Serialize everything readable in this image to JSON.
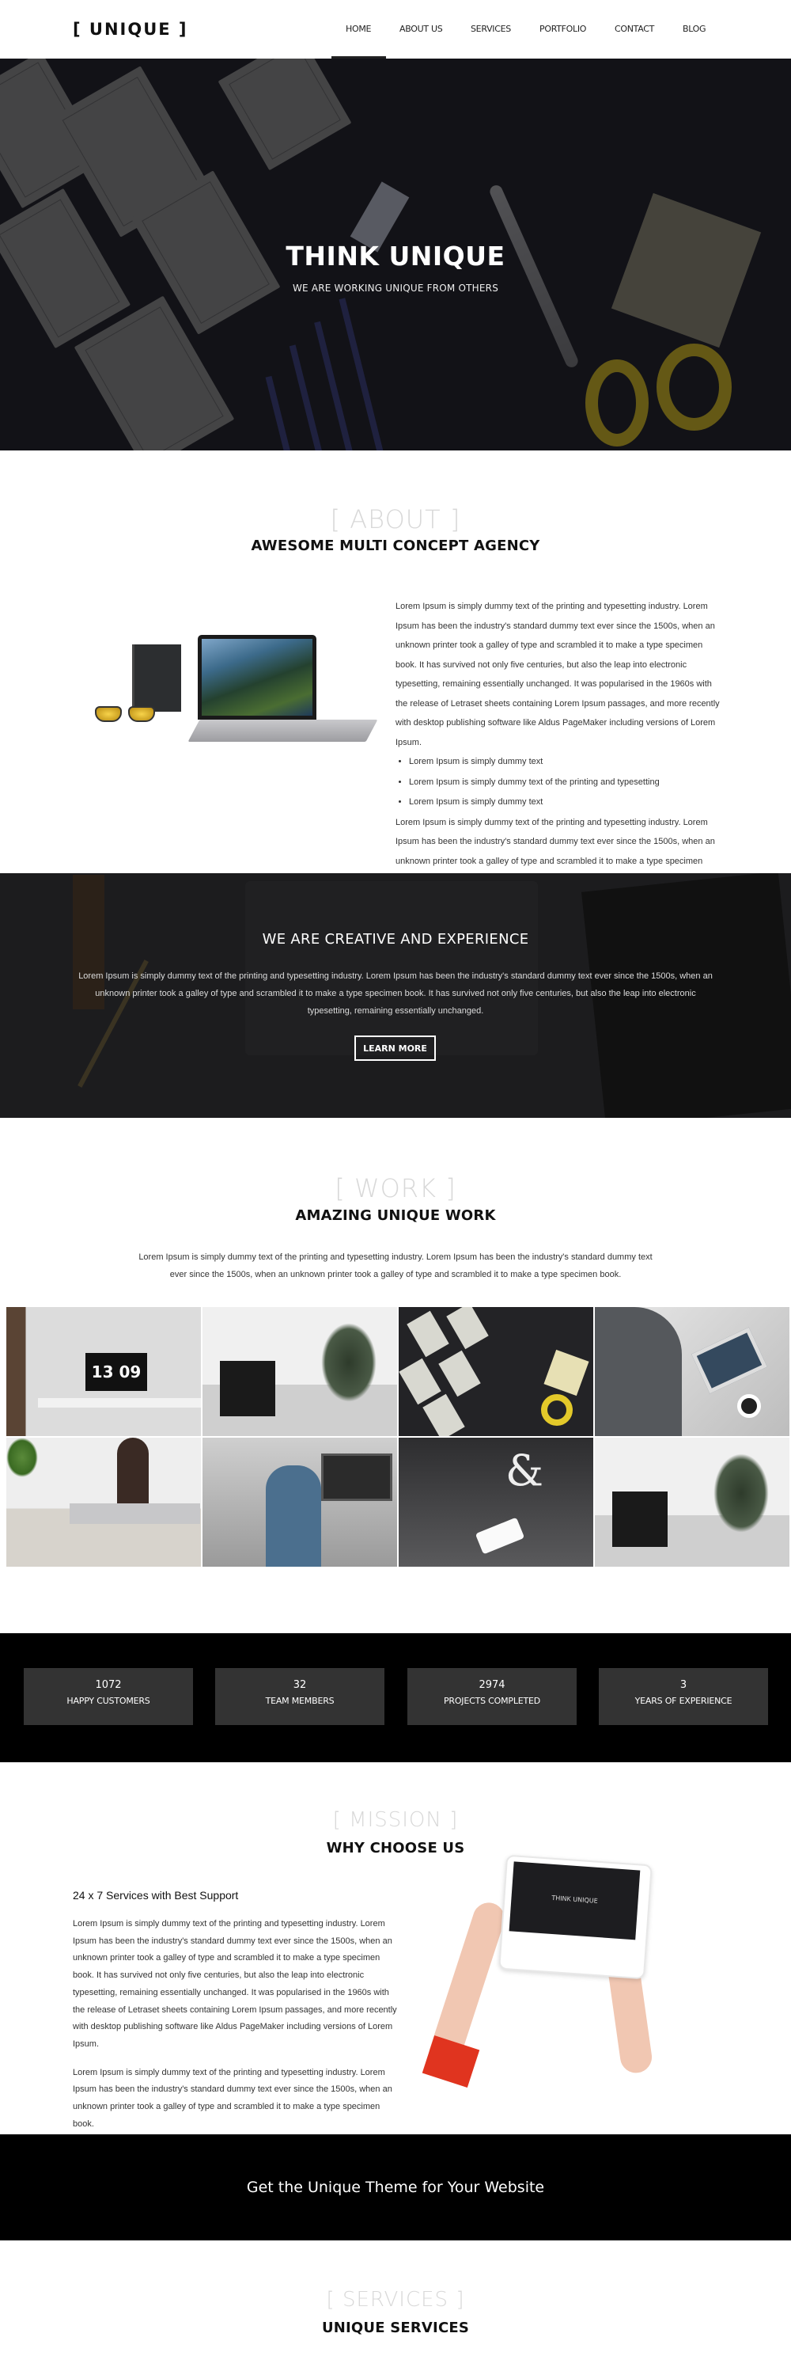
{
  "nav": {
    "logo": "[ UNIQUE ]",
    "items": [
      {
        "label": "HOME",
        "active": true
      },
      {
        "label": "ABOUT US"
      },
      {
        "label": "SERVICES"
      },
      {
        "label": "PORTFOLIO"
      },
      {
        "label": "CONTACT"
      },
      {
        "label": "BLOG"
      }
    ]
  },
  "hero": {
    "title": "THINK UNIQUE",
    "subtitle": "WE ARE WORKING UNIQUE FROM OTHERS"
  },
  "about": {
    "tag": "[ ABOUT ]",
    "title": "AWESOME MULTI CONCEPT AGENCY",
    "paragraph1": "Lorem Ipsum is simply dummy text of the printing and typesetting industry. Lorem Ipsum has been the industry's standard dummy text ever since the 1500s, when an unknown printer took a galley of type and scrambled it to make a type specimen book. It has survived not only five centuries, but also the leap into electronic typesetting, remaining essentially unchanged. It was popularised in the 1960s with the release of Letraset sheets containing Lorem Ipsum passages, and more recently with desktop publishing software like Aldus PageMaker including versions of Lorem Ipsum.",
    "bullets": [
      "Lorem Ipsum is simply dummy text",
      "Lorem Ipsum is simply dummy text of the printing and typesetting",
      "Lorem Ipsum is simply dummy text"
    ],
    "paragraph2": "Lorem Ipsum is simply dummy text of the printing and typesetting industry. Lorem Ipsum has been the industry's standard dummy text ever since the 1500s, when an unknown printer took a galley of type and scrambled it to make a type specimen book."
  },
  "creative": {
    "title": "WE ARE CREATIVE AND EXPERIENCE",
    "text": "Lorem Ipsum is simply dummy text of the printing and typesetting industry. Lorem Ipsum has been the industry's standard dummy text ever since the 1500s, when an unknown printer took a galley of type and scrambled it to make a type specimen book. It has survived not only five centuries, but also the leap into electronic typesetting, remaining essentially unchanged.",
    "button": "LEARN MORE"
  },
  "work": {
    "tag": "[ WORK ]",
    "title": "AMAZING UNIQUE WORK",
    "description": "Lorem Ipsum is simply dummy text of the printing and typesetting industry. Lorem Ipsum has been the industry's standard dummy text ever since the 1500s, when an unknown printer took a galley of type and scrambled it to make a type specimen book.",
    "gallery": [
      {
        "subject": "desk with monitor clock",
        "clock": "13 09"
      },
      {
        "subject": "office with plant"
      },
      {
        "subject": "wireframe sketches and scissors"
      },
      {
        "subject": "man using tablet with coffee"
      },
      {
        "subject": "laptop and glasses on desk"
      },
      {
        "subject": "people working at computers"
      },
      {
        "subject": "ampersand and phone on sofa",
        "glyph": "&"
      },
      {
        "subject": "office with plant"
      }
    ]
  },
  "stats": [
    {
      "number": "1072",
      "label": "HAPPY CUSTOMERS"
    },
    {
      "number": "32",
      "label": "TEAM MEMBERS"
    },
    {
      "number": "2974",
      "label": "PROJECTS COMPLETED"
    },
    {
      "number": "3",
      "label": "YEARS OF EXPERIENCE"
    }
  ],
  "mission": {
    "tag": "[ MISSION ]",
    "title": "WHY CHOOSE US",
    "subtitle": "24 x 7 Services with Best Support",
    "paragraph1": "Lorem Ipsum is simply dummy text of the printing and typesetting industry. Lorem Ipsum has been the industry's standard dummy text ever since the 1500s, when an unknown printer took a galley of type and scrambled it to make a type specimen book. It has survived not only five centuries, but also the leap into electronic typesetting, remaining essentially unchanged. It was popularised in the 1960s with the release of Letraset sheets containing Lorem Ipsum passages, and more recently with desktop publishing software like Aldus PageMaker including versions of Lorem Ipsum.",
    "paragraph2": "Lorem Ipsum is simply dummy text of the printing and typesetting industry. Lorem Ipsum has been the industry's standard dummy text ever since the 1500s, when an unknown printer took a galley of type and scrambled it to make a type specimen book.",
    "tablet_screen_text": "THINK UNIQUE"
  },
  "cta": {
    "text": "Get the Unique Theme for Your Website"
  },
  "services": {
    "tag": "[ SERVICES ]",
    "title": "UNIQUE SERVICES"
  }
}
